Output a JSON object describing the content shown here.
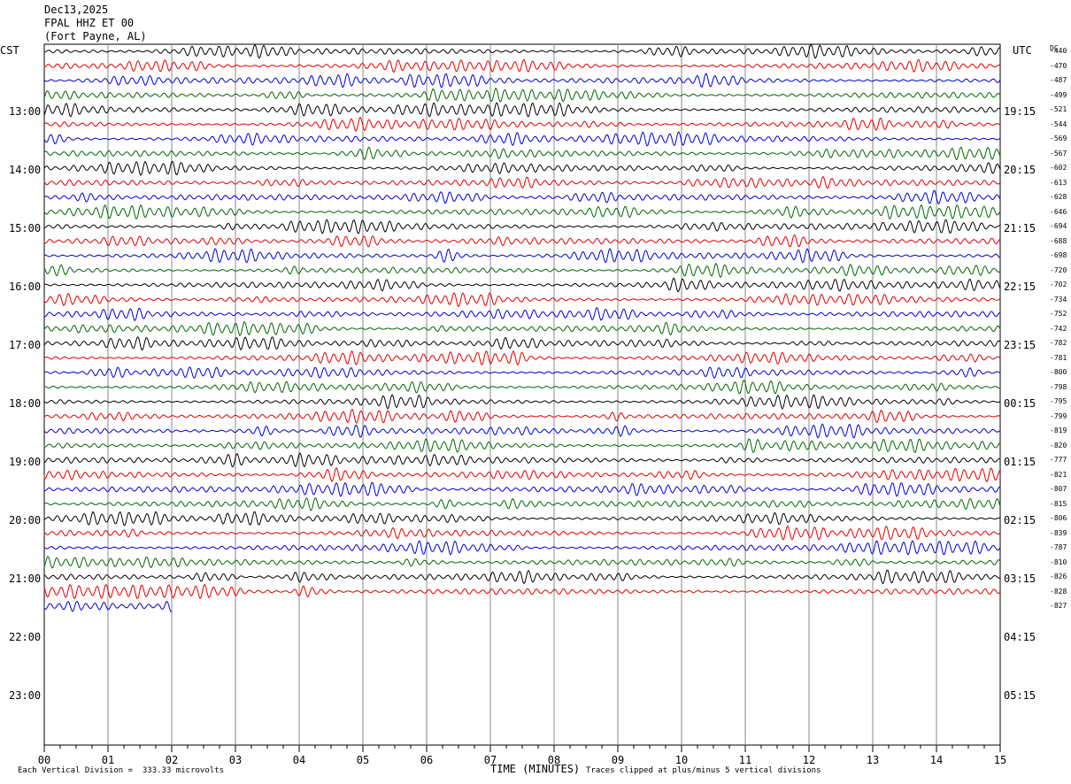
{
  "header": {
    "date": "Dec13,2025",
    "station": "FPAL HHZ ET 00",
    "location": "(Fort Payne, AL)"
  },
  "left_zone": "CST",
  "right_zone": "UTC",
  "dc_header": "DC",
  "colors": {
    "trace": [
      "#000000",
      "#dd0000",
      "#0000cc",
      "#006600"
    ],
    "grid": "#888888"
  },
  "chart_data": {
    "type": "line",
    "title": "FPAL HHZ ET 00",
    "xlabel": "TIME (MINUTES)",
    "xlim": [
      0,
      15
    ],
    "x_ticks": [
      "00",
      "01",
      "02",
      "03",
      "04",
      "05",
      "06",
      "07",
      "08",
      "09",
      "10",
      "11",
      "12",
      "13",
      "14",
      "15"
    ],
    "left_time_labels": [
      "13:00",
      "14:00",
      "15:00",
      "16:00",
      "17:00",
      "18:00",
      "19:00",
      "20:00",
      "21:00",
      "22:00",
      "23:00"
    ],
    "right_time_labels": [
      "19:15",
      "20:15",
      "21:15",
      "22:15",
      "23:15",
      "00:15",
      "01:15",
      "02:15",
      "03:15",
      "04:15",
      "05:15"
    ],
    "dc_offsets": [
      "-440",
      "-470",
      "-487",
      "-499",
      "-521",
      "-544",
      "-569",
      "-567",
      "-602",
      "-613",
      "-628",
      "-646",
      "-694",
      "-688",
      "-698",
      "-720",
      "-702",
      "-734",
      "-752",
      "-742",
      "-782",
      "-781",
      "-800",
      "-798",
      "-795",
      "-799",
      "-819",
      "-820",
      "-777",
      "-821",
      "-807",
      "-815",
      "-806",
      "-839",
      "-787",
      "-810",
      "-826",
      "-828",
      "-827"
    ],
    "traces_count": 39,
    "last_trace_end_minute": 2,
    "scale_note": "Each Vertical Division =  333.33 microvolts",
    "clip_note": "Traces clipped at plus/minus 5 vertical divisions"
  }
}
